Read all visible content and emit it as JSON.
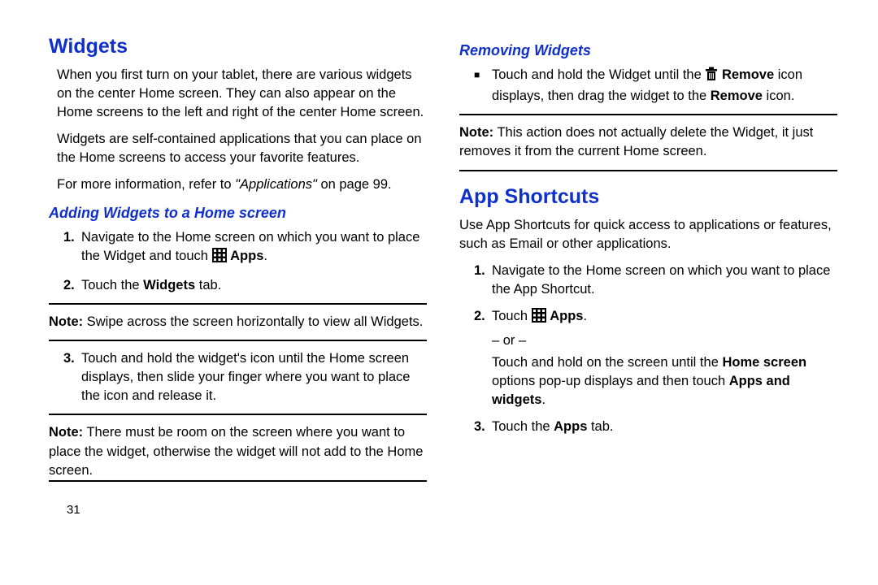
{
  "left": {
    "h1": "Widgets",
    "p1": "When you first turn on your tablet, there are various widgets on the center Home screen. They can also appear on the Home screens to the left and right of the center Home screen.",
    "p2": "Widgets are self-contained applications that you can place on the Home screens to access your favorite features.",
    "p3_pre": "For more information, refer to ",
    "p3_em": "\"Applications\"",
    "p3_post": " on page 99.",
    "h2": "Adding Widgets to a Home screen",
    "step1_pre": "Navigate to the Home screen on which you want to place the Widget and touch ",
    "step1_apps": "Apps",
    "step1_post": ".",
    "step2_pre": "Touch the ",
    "step2_b": "Widgets",
    "step2_post": " tab.",
    "note1_label": "Note:",
    "note1_body": "Swipe across the screen horizontally to view all Widgets.",
    "step3": "Touch and hold the widget's icon until the Home screen displays, then slide your finger where you want to place the icon and release it.",
    "note2_label": "Note:",
    "note2_body": "There must be room on the screen where you want to place the widget, otherwise the widget will not add to the Home screen.",
    "pagenum": "31"
  },
  "right": {
    "h2a": "Removing Widgets",
    "bul_pre": "Touch and hold the Widget until the ",
    "bul_b1": "Remove",
    "bul_mid": " icon displays, then drag the widget to the ",
    "bul_b2": "Remove",
    "bul_post": " icon.",
    "note_label": "Note:",
    "note_body": "This action does not actually delete the Widget, it just removes it from the current Home screen.",
    "h1": "App Shortcuts",
    "p1": "Use App Shortcuts for quick access to applications or features, such as Email or other applications.",
    "step1": "Navigate to the Home screen on which you want to place the App Shortcut.",
    "step2_pre": "Touch ",
    "step2_apps": "Apps",
    "step2_post": ".",
    "step2_or": "– or –",
    "step2_alt_pre": "Touch and hold on the screen until the ",
    "step2_alt_b1": "Home screen",
    "step2_alt_mid": " options pop-up displays and then touch ",
    "step2_alt_b2": "Apps and widgets",
    "step2_alt_post": ".",
    "step3_pre": "Touch the ",
    "step3_b": "Apps",
    "step3_post": " tab."
  },
  "nums": {
    "n1": "1.",
    "n2": "2.",
    "n3": "3."
  }
}
